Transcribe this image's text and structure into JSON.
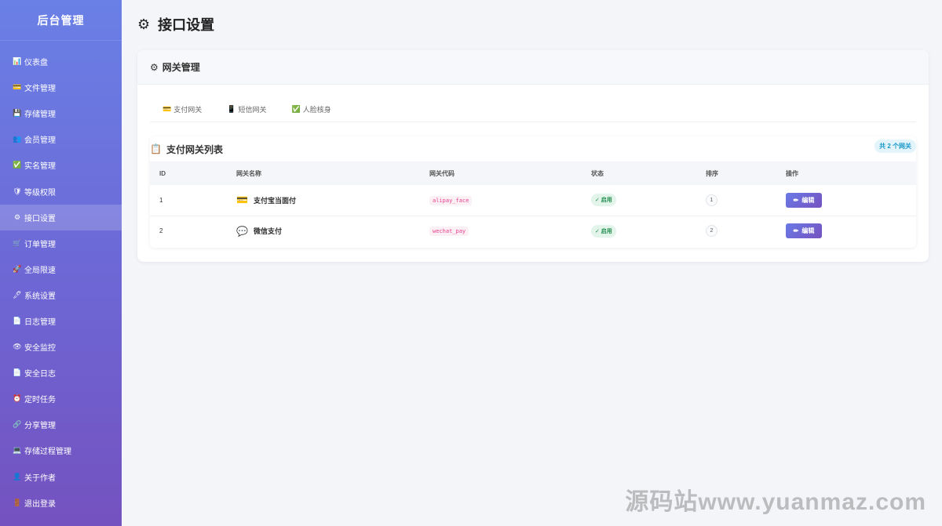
{
  "sidebar": {
    "brand": "后台管理",
    "items": [
      {
        "icon": "📊",
        "label": "仪表盘"
      },
      {
        "icon": "💳",
        "label": "文件管理"
      },
      {
        "icon": "💾",
        "label": "存储管理"
      },
      {
        "icon": "👥",
        "label": "会员管理"
      },
      {
        "icon": "✅",
        "label": "实名管理"
      },
      {
        "icon": "🛡",
        "label": "等级权限"
      },
      {
        "icon": "⚙",
        "label": "接口设置",
        "active": true
      },
      {
        "icon": "🛒",
        "label": "订单管理"
      },
      {
        "icon": "🚀",
        "label": "全局限速"
      },
      {
        "icon": "🖊",
        "label": "系统设置"
      },
      {
        "icon": "📄",
        "label": "日志管理"
      },
      {
        "icon": "👁",
        "label": "安全监控"
      },
      {
        "icon": "📄",
        "label": "安全日志"
      },
      {
        "icon": "⏰",
        "label": "定时任务"
      },
      {
        "icon": "🔗",
        "label": "分享管理"
      },
      {
        "icon": "💻",
        "label": "存储过程管理"
      },
      {
        "icon": "👤",
        "label": "关于作者"
      },
      {
        "icon": "🚪",
        "label": "退出登录"
      }
    ]
  },
  "page": {
    "title": "接口设置",
    "title_icon": "gear-icon"
  },
  "card": {
    "header": "网关管理",
    "tabs": [
      {
        "icon": "💳",
        "label": "支付网关"
      },
      {
        "icon": "📱",
        "label": "短信网关"
      },
      {
        "icon": "✅",
        "label": "人脸核身"
      }
    ],
    "list": {
      "title": "支付网关列表",
      "count": "共 2 个网关",
      "columns": [
        "ID",
        "网关名称",
        "网关代码",
        "状态",
        "排序",
        "操作"
      ],
      "rows": [
        {
          "id": "1",
          "icon": "💳",
          "name": "支付宝当面付",
          "code": "alipay_face",
          "status": "✓ 启用",
          "sort": "1",
          "action": "编辑"
        },
        {
          "id": "2",
          "icon": "💬",
          "name": "微信支付",
          "code": "wechat_pay",
          "status": "✓ 启用",
          "sort": "2",
          "action": "编辑"
        }
      ]
    }
  },
  "watermark": "源码站www.yuanmaz.com"
}
